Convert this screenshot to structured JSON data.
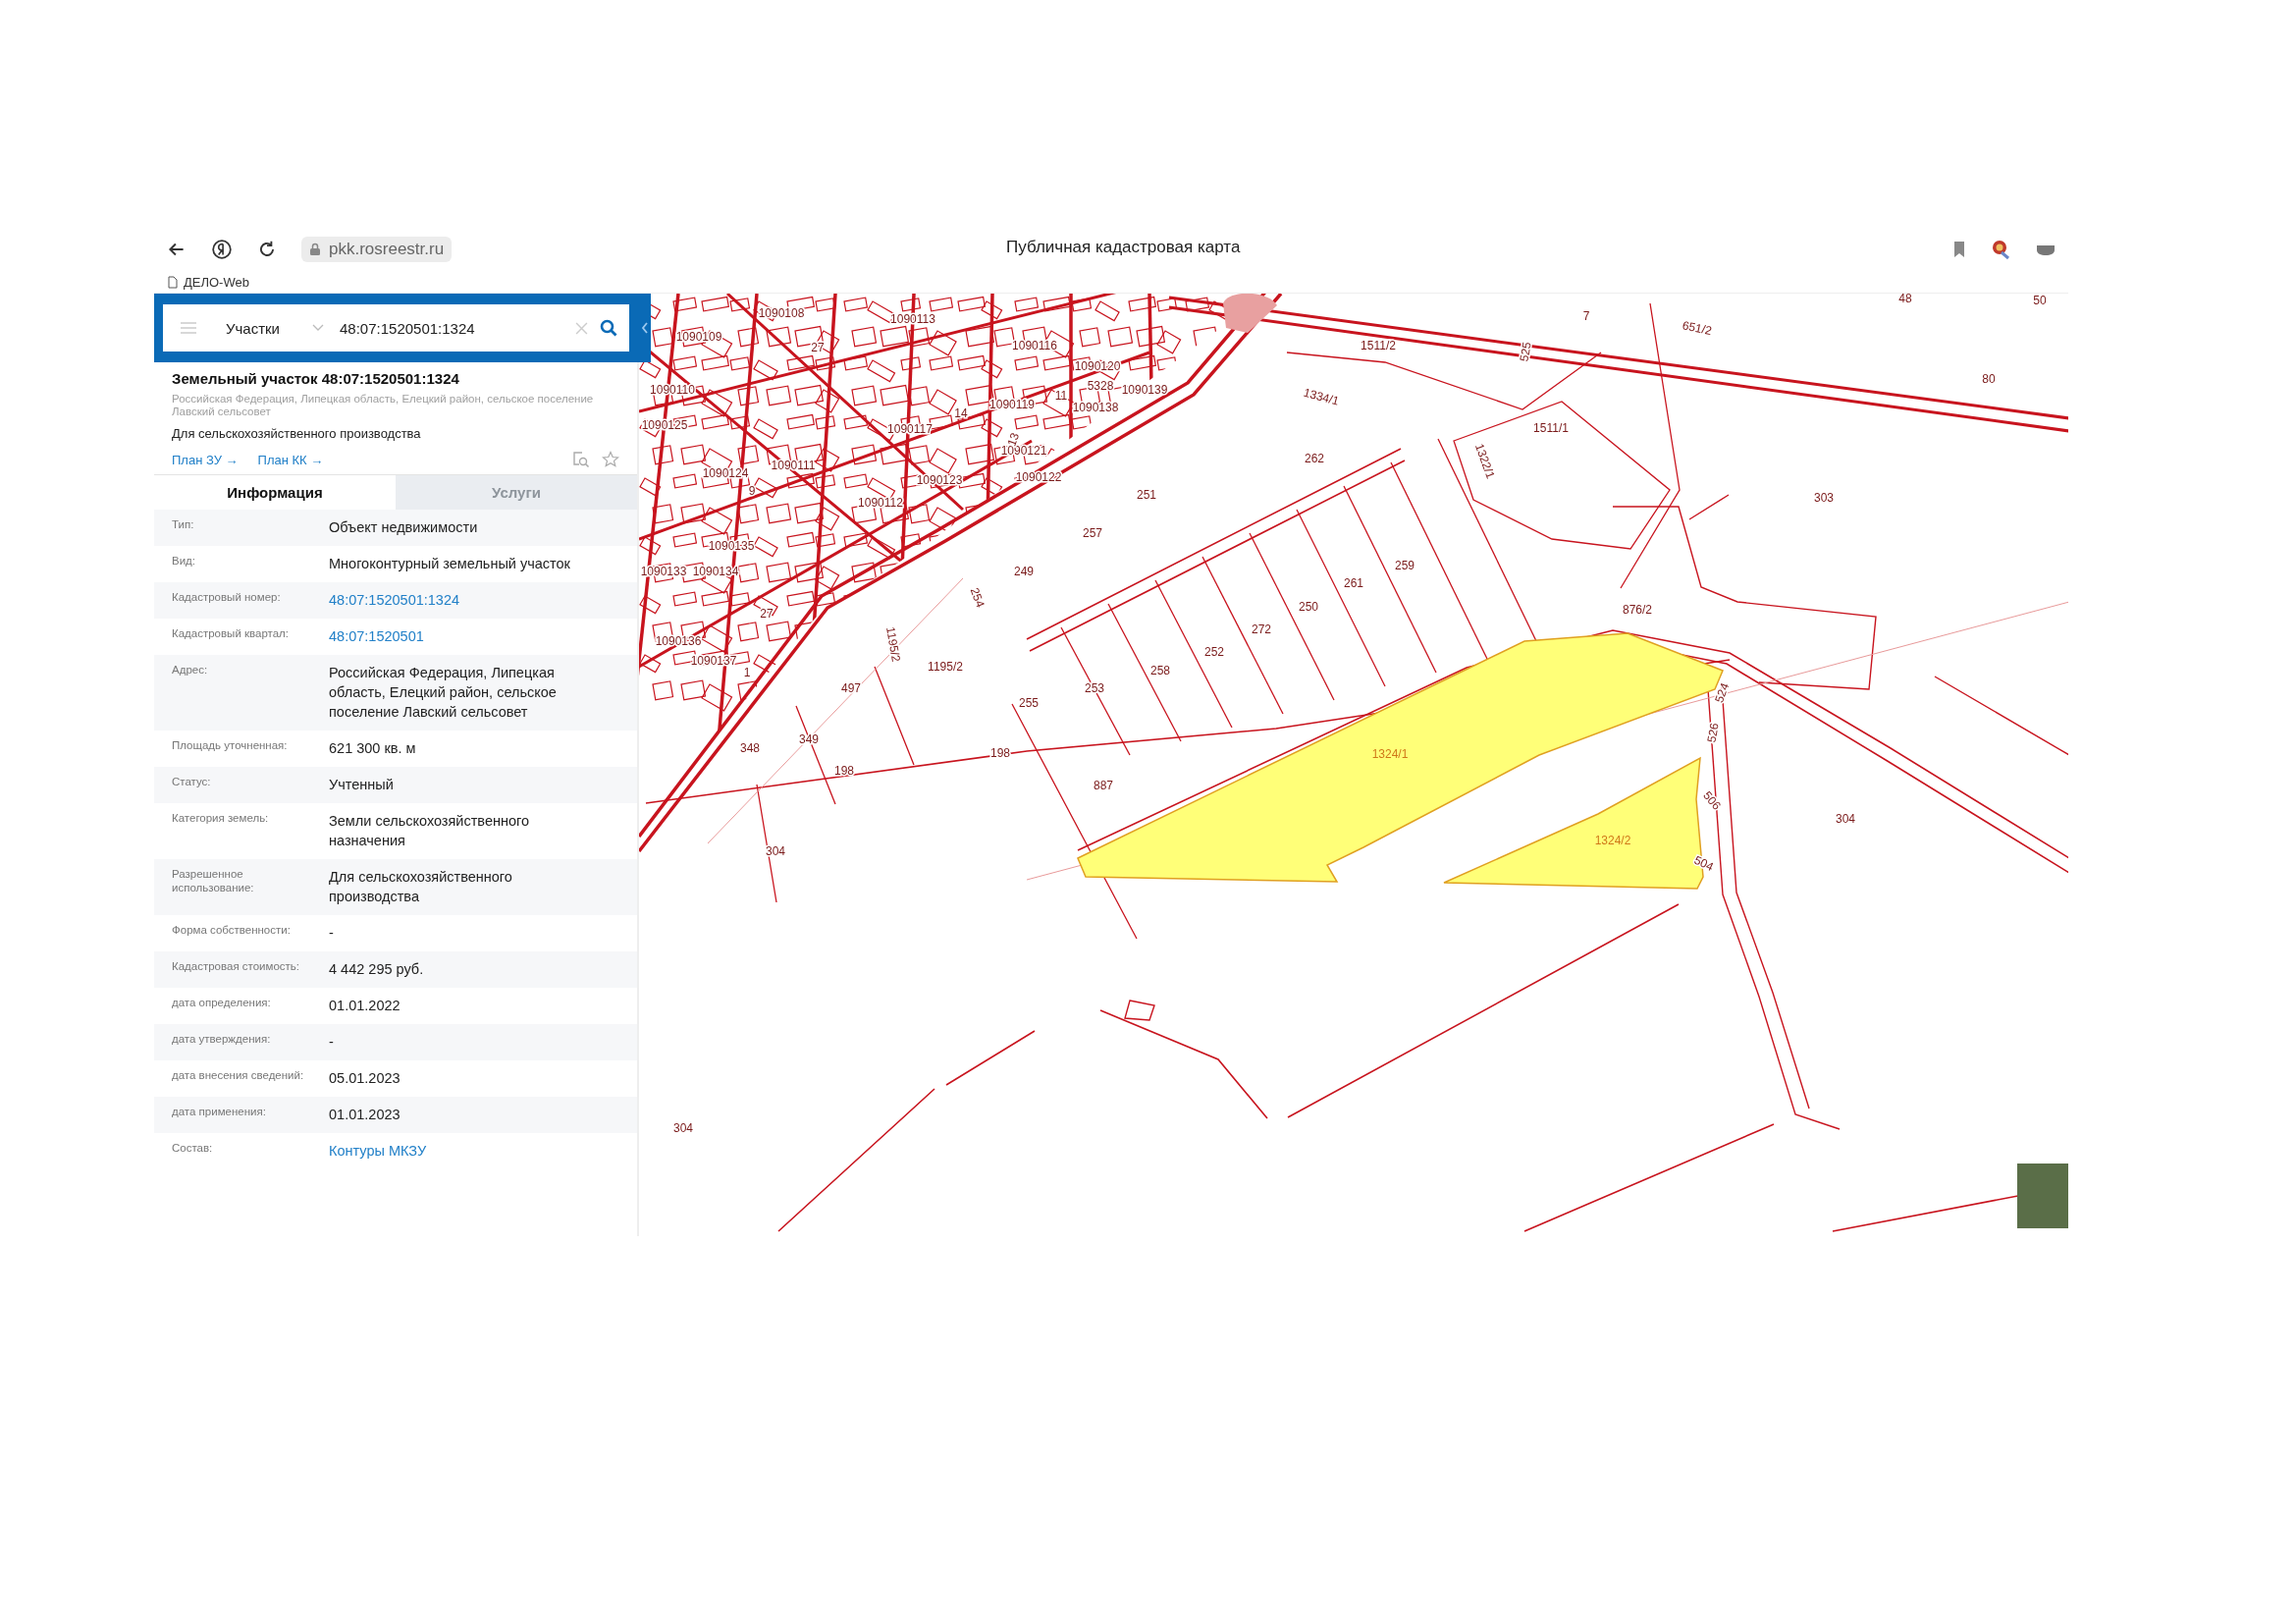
{
  "browser": {
    "url": "pkk.rosreestr.ru",
    "title": "Публичная кадастровая карта",
    "bookmarks": [
      "ДЕЛО-Web"
    ]
  },
  "search": {
    "layer": "Участки",
    "value": "48:07:1520501:1324"
  },
  "object": {
    "title": "Земельный участок 48:07:1520501:1324",
    "address": "Российская Федерация, Липецкая область, Елецкий район, сельское поселение Лавский сельсовет",
    "purpose": "Для сельскохозяйственного производства",
    "links": [
      "План ЗУ →",
      "План КК →"
    ]
  },
  "tabs": [
    {
      "label": "Информация",
      "selected": true
    },
    {
      "label": "Услуги",
      "selected": false
    }
  ],
  "rows": [
    {
      "label": "Тип:",
      "value": "Объект недвижимости",
      "kind": "text"
    },
    {
      "label": "Вид:",
      "value": "Многоконтурный земельный участок",
      "kind": "text"
    },
    {
      "label": "Кадастровый номер:",
      "value": "48:07:1520501:1324",
      "kind": "link"
    },
    {
      "label": "Кадастровый квартал:",
      "value": "48:07:1520501",
      "kind": "link"
    },
    {
      "label": "Адрес:",
      "value": "Российская Федерация, Липецкая область, Елецкий район, сельское поселение Лавский сельсовет",
      "kind": "text"
    },
    {
      "label": "Площадь уточненная:",
      "value": "621 300 кв. м",
      "kind": "text"
    },
    {
      "label": "Статус:",
      "value": "Учтенный",
      "kind": "text"
    },
    {
      "label": "Категория земель:",
      "value": "Земли сельскохозяйственного назначения",
      "kind": "text"
    },
    {
      "label": "Разрешенное использование:",
      "value": "Для сельскохозяйственного производства",
      "kind": "text"
    },
    {
      "label": "Форма собственности:",
      "value": "-",
      "kind": "text"
    },
    {
      "label": "Кадастровая стоимость:",
      "value": "4 442 295 руб.",
      "kind": "text"
    },
    {
      "label": "дата определения:",
      "value": "01.01.2022",
      "kind": "text"
    },
    {
      "label": "дата утверждения:",
      "value": "-",
      "kind": "text"
    },
    {
      "label": "дата внесения сведений:",
      "value": "05.01.2023",
      "kind": "text"
    },
    {
      "label": "дата применения:",
      "value": "01.01.2023",
      "kind": "text"
    },
    {
      "label": "Состав:",
      "value": "Контуры МКЗУ",
      "kind": "link"
    }
  ],
  "map": {
    "selected_parcels": [
      "1324/1",
      "1324/2"
    ],
    "parcel_labels": [
      "1090108",
      "1090109",
      "1090110",
      "1090125",
      "1090124",
      "1090111",
      "1090112",
      "1090113",
      "1090116",
      "1090117",
      "1090119",
      "1090120",
      "1090121",
      "1090123",
      "1090122",
      "1090138",
      "1090139",
      "5328",
      "1090135",
      "1090133",
      "1090134",
      "1090136",
      "1090137",
      "27",
      "9",
      "14",
      "13",
      "11",
      "27",
      "1",
      "1511/2",
      "1334/1",
      "262",
      "251",
      "257",
      "249",
      "254",
      "259",
      "261",
      "250",
      "272",
      "252",
      "258",
      "253",
      "255",
      "1195/2",
      "1195/2",
      "497",
      "349",
      "348",
      "198",
      "198",
      "887",
      "304",
      "304",
      "304",
      "303",
      "876/2",
      "1511/1",
      "1322/1",
      "525",
      "7",
      "651/2",
      "48",
      "50",
      "80",
      "524",
      "526",
      "506",
      "504"
    ]
  }
}
